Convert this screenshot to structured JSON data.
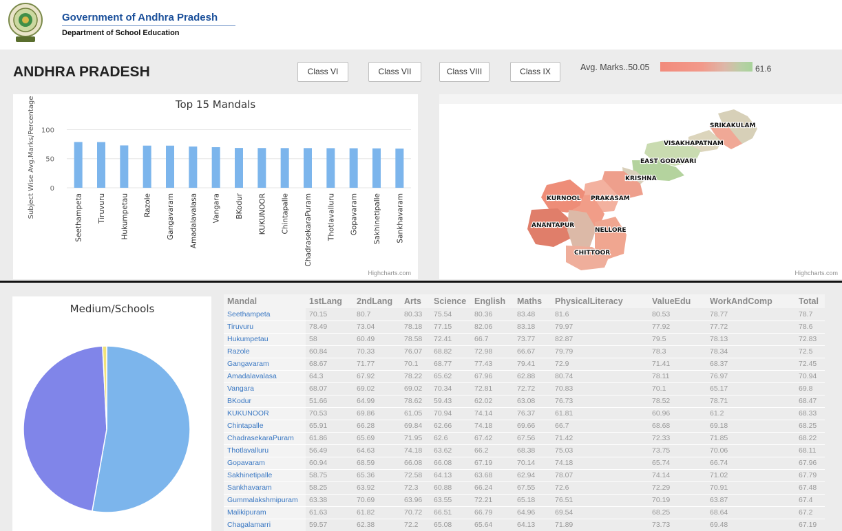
{
  "header": {
    "org_title": "Government of Andhra Pradesh",
    "department": "Department of School Education"
  },
  "toolbar": {
    "state_title": "ANDHRA PRADESH",
    "class_buttons": [
      "Class VI",
      "Class VII",
      "Class VIII",
      "Class IX"
    ],
    "legend_label": "Avg. Marks..50.05",
    "legend_max": "61.6",
    "legend_colors": [
      "#f28b7c",
      "#a8d39a"
    ]
  },
  "bar_chart": {
    "credit": "Highcharts.com"
  },
  "chart_data": [
    {
      "type": "bar",
      "title": "Top 15 Mandals",
      "xlabel": "",
      "ylabel": "Subject Wise Avg.Marks/Percentage",
      "categories": [
        "Seethampeta",
        "Tiruvuru",
        "Hukumpetau",
        "Razole",
        "Gangavaram",
        "Amadalavalasa",
        "Vangara",
        "BKodur",
        "KUKUNOOR",
        "Chintapalle",
        "ChadrasekaraPuram",
        "Thotlavalluru",
        "Gopavaram",
        "Sakhinetipalle",
        "Sankhavaram"
      ],
      "values": [
        78.7,
        78.6,
        72.83,
        72.5,
        72.45,
        70.94,
        69.8,
        68.47,
        68.33,
        68.25,
        68.22,
        68.11,
        67.96,
        67.79,
        67.48
      ],
      "yticks": [
        "0",
        "50",
        "100"
      ],
      "ylim": [
        0,
        110
      ],
      "grid": true,
      "color": "#7cb5ec"
    },
    {
      "type": "pie",
      "title": "Medium/Schools",
      "values": [
        52.8,
        46.4,
        0.8
      ],
      "colors": [
        "#7cb5ec",
        "#8085e9",
        "#f1e27a"
      ]
    }
  ],
  "map": {
    "labels": [
      "SRIKAKULAM",
      "VISAKHAPATNAM",
      "EAST GODAVARI",
      "KRISHNA",
      "KURNOOL",
      "PRAKASAM",
      "ANANTAPUR",
      "NELLORE",
      "CHITTOOR"
    ],
    "credit": "Highcharts.com"
  },
  "table": {
    "columns": [
      "Mandal",
      "1stLang",
      "2ndLang",
      "Arts",
      "Science",
      "English",
      "Maths",
      "PhysicalLiteracy",
      "ValueEdu",
      "WorkAndComp",
      "Total"
    ],
    "rows": [
      [
        "Seethampeta",
        "70.15",
        "80.7",
        "80.33",
        "75.54",
        "80.36",
        "83.48",
        "81.6",
        "80.53",
        "78.77",
        "78.7"
      ],
      [
        "Tiruvuru",
        "78.49",
        "73.04",
        "78.18",
        "77.15",
        "82.06",
        "83.18",
        "79.97",
        "77.92",
        "77.72",
        "78.6"
      ],
      [
        "Hukumpetau",
        "58",
        "60.49",
        "78.58",
        "72.41",
        "66.7",
        "73.77",
        "82.87",
        "79.5",
        "78.13",
        "72.83"
      ],
      [
        "Razole",
        "60.84",
        "70.33",
        "76.07",
        "68.82",
        "72.98",
        "66.67",
        "79.79",
        "78.3",
        "78.34",
        "72.5"
      ],
      [
        "Gangavaram",
        "68.67",
        "71.77",
        "70.1",
        "68.77",
        "77.43",
        "79.41",
        "72.9",
        "71.41",
        "68.37",
        "72.45"
      ],
      [
        "Amadalavalasa",
        "64.3",
        "67.92",
        "78.22",
        "65.62",
        "67.96",
        "62.88",
        "80.74",
        "78.11",
        "76.97",
        "70.94"
      ],
      [
        "Vangara",
        "68.07",
        "69.02",
        "69.02",
        "70.34",
        "72.81",
        "72.72",
        "70.83",
        "70.1",
        "65.17",
        "69.8"
      ],
      [
        "BKodur",
        "51.66",
        "64.99",
        "78.62",
        "59.43",
        "62.02",
        "63.08",
        "76.73",
        "78.52",
        "78.71",
        "68.47"
      ],
      [
        "KUKUNOOR",
        "70.53",
        "69.86",
        "61.05",
        "70.94",
        "74.14",
        "76.37",
        "61.81",
        "60.96",
        "61.2",
        "68.33"
      ],
      [
        "Chintapalle",
        "65.91",
        "66.28",
        "69.84",
        "62.66",
        "74.18",
        "69.66",
        "66.7",
        "68.68",
        "69.18",
        "68.25"
      ],
      [
        "ChadrasekaraPuram",
        "61.86",
        "65.69",
        "71.95",
        "62.6",
        "67.42",
        "67.56",
        "71.42",
        "72.33",
        "71.85",
        "68.22"
      ],
      [
        "Thotlavalluru",
        "56.49",
        "64.63",
        "74.18",
        "63.62",
        "66.2",
        "68.38",
        "75.03",
        "73.75",
        "70.06",
        "68.11"
      ],
      [
        "Gopavaram",
        "60.94",
        "68.59",
        "66.08",
        "66.08",
        "67.19",
        "70.14",
        "74.18",
        "65.74",
        "66.74",
        "67.96"
      ],
      [
        "Sakhinetipalle",
        "58.75",
        "65.36",
        "72.58",
        "64.13",
        "63.68",
        "62.94",
        "78.07",
        "74.14",
        "71.02",
        "67.79"
      ],
      [
        "Sankhavaram",
        "58.25",
        "63.92",
        "72.3",
        "60.88",
        "66.24",
        "67.55",
        "72.6",
        "72.29",
        "70.91",
        "67.48"
      ],
      [
        "Gummalakshmipuram",
        "63.38",
        "70.69",
        "63.96",
        "63.55",
        "72.21",
        "65.18",
        "76.51",
        "70.19",
        "63.87",
        "67.4"
      ],
      [
        "Malikipuram",
        "61.63",
        "61.82",
        "70.72",
        "66.51",
        "66.79",
        "64.96",
        "69.54",
        "68.25",
        "68.64",
        "67.2"
      ],
      [
        "Chagalamarri",
        "59.57",
        "62.38",
        "72.2",
        "65.08",
        "65.64",
        "64.13",
        "71.89",
        "73.73",
        "69.48",
        "67.19"
      ]
    ]
  }
}
